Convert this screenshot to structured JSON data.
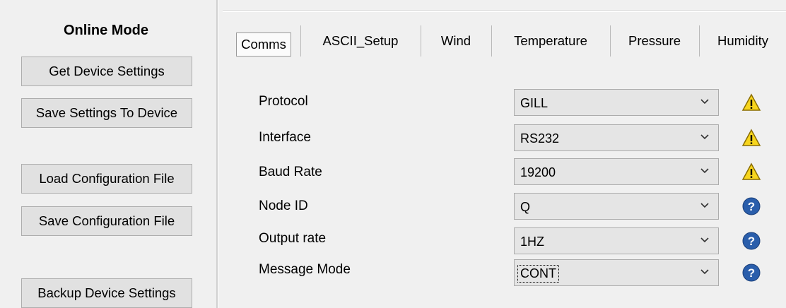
{
  "left_panel": {
    "title": "Online Mode",
    "buttons": {
      "get_device_settings": "Get Device Settings",
      "save_settings_to_device": "Save Settings To Device",
      "load_configuration_file": "Load Configuration File",
      "save_configuration_file": "Save Configuration File",
      "backup_device_settings": "Backup Device Settings"
    }
  },
  "tabs": [
    "Comms",
    "ASCII_Setup",
    "Wind",
    "Temperature",
    "Pressure",
    "Humidity"
  ],
  "active_tab": "Comms",
  "settings": [
    {
      "label": "Protocol",
      "value": "GILL",
      "status_icon": "warning-icon"
    },
    {
      "label": "Interface",
      "value": "RS232",
      "status_icon": "warning-icon"
    },
    {
      "label": "Baud Rate",
      "value": "19200",
      "status_icon": "warning-icon"
    },
    {
      "label": "Node ID",
      "value": "Q",
      "status_icon": "help-icon"
    },
    {
      "label": "Output rate",
      "value": "1HZ",
      "status_icon": "help-icon"
    },
    {
      "label": "Message Mode",
      "value": "CONT",
      "status_icon": "help-icon"
    }
  ],
  "colors": {
    "warning_fill": "#f7d51d",
    "help_fill": "#2a5eab",
    "background": "#f0f0f0"
  }
}
